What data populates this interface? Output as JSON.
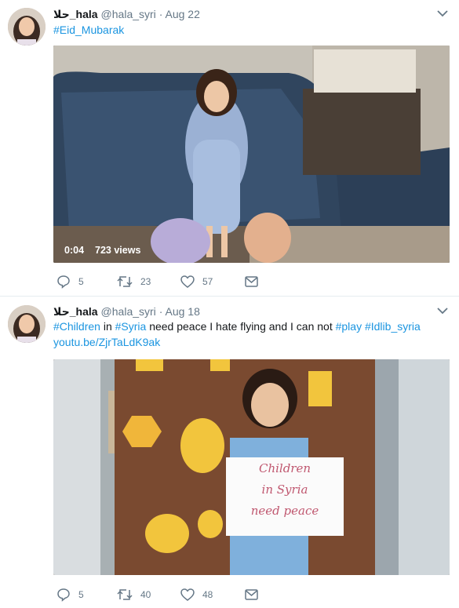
{
  "tweets": [
    {
      "author_name": "حلا_hala",
      "handle": "@hala_syri",
      "date": "Aug 22",
      "text_parts": [
        {
          "text": "#Eid_Mubarak",
          "link": true
        }
      ],
      "video": {
        "duration": "0:04",
        "views": "723 views"
      },
      "actions": {
        "replies": "5",
        "retweets": "23",
        "likes": "57"
      }
    },
    {
      "author_name": "حلا_hala",
      "handle": "@hala_syri",
      "date": "Aug 18",
      "text_parts": [
        {
          "text": "#Children",
          "link": true
        },
        {
          "text": " in ",
          "link": false
        },
        {
          "text": "#Syria",
          "link": true
        },
        {
          "text": " need peace I hate flying and I can not ",
          "link": false
        },
        {
          "text": "#play",
          "link": true
        },
        {
          "text": "  ",
          "link": false
        },
        {
          "text": "#Idlib_syria",
          "link": true
        }
      ],
      "url": "youtu.be/ZjrTaLdK9ak",
      "image_sign": {
        "line1": "Children",
        "line2": "in Syria",
        "line3": "need peace"
      },
      "actions": {
        "replies": "5",
        "retweets": "40",
        "likes": "48"
      }
    }
  ],
  "separator": "·",
  "colors": {
    "link": "#1b95e0",
    "secondary": "#657786",
    "text": "#14171a",
    "border": "#e6ecf0"
  },
  "icons": [
    "reply-icon",
    "retweet-icon",
    "heart-icon",
    "direct-message-icon",
    "chevron-down-icon"
  ]
}
